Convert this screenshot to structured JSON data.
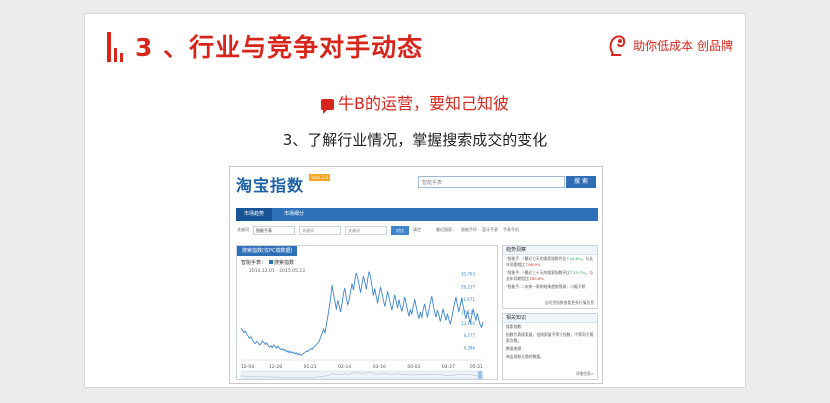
{
  "slide": {
    "title": "3 、行业与竞争对手动态",
    "brand": "助你低成本 创品牌",
    "subtitle": "牛B的运营，要知己知彼",
    "point": "3、了解行业情况，掌握搜索成交的变化",
    "colors": {
      "accent": "#d9261c",
      "blue": "#2f71b8"
    }
  },
  "screenshot": {
    "logo": "淘宝指数",
    "beta": "beta 2.0",
    "search_value": "智能手表",
    "search_button": "搜 索",
    "nav": [
      "市场趋势",
      "市场细分"
    ],
    "filters": {
      "kw1_label": "关键词",
      "kw1": "智能手表",
      "kw2": "关键词",
      "kw3": "关键词",
      "compare": "对比",
      "clear": "清空",
      "recent_label": "最近搜索：",
      "recent": [
        "智能手环",
        "蓝牙手表",
        "手表手机"
      ]
    },
    "chart": {
      "tab": "搜索指数(仅PC端数据)",
      "series_label": "智能手表：",
      "legend": "搜索指数",
      "date_range": "2014.12.01 - 2015.05.23"
    },
    "insight": {
      "title": "趋势洞察",
      "lines": [
        {
          "text": "\"智能手...\"最近七天的搜索指数环比",
          "val": "↑20.8%",
          "dir": "up",
          "tail": "，与去年同期相比",
          "val2": "↑98.9%",
          "dir2": "dn"
        },
        {
          "text": "\"智能手...\"最近三十天的搜索指数环比",
          "val": "↑13.7%",
          "dir": "up",
          "tail": "，与去年同期相比",
          "val2": "↑85.6%",
          "dir2": "dn"
        },
        {
          "text": "\"智能手...\"未来一周的结果趋势预测：小幅下跌",
          "val": "",
          "dir": "",
          "tail": "",
          "val2": "",
          "dir2": ""
        }
      ],
      "more": "去阿里指数查看更多行情信息"
    },
    "knowledge": {
      "title": "相关知识",
      "lines": [
        "搜索指数：",
        "指数代表搜索量，但搜索量不等于指数，不等同于搜索次数。",
        "数据来源：",
        "淘宝网和天猫的数据。"
      ],
      "more": "详细信息>"
    }
  },
  "chart_data": {
    "type": "line",
    "title": "搜索指数(仅PC端数据)",
    "series": [
      {
        "name": "搜索指数",
        "values": [
          11400,
          10600,
          9900,
          10400,
          9200,
          8600,
          7800,
          8300,
          7100,
          6400,
          5900,
          6700,
          6100,
          5400,
          5800,
          6800,
          6300,
          5600,
          6100,
          5200,
          4700,
          5100,
          4400,
          5400,
          4800,
          4300,
          5000,
          4200,
          3700,
          4100,
          3400,
          3800,
          2900,
          3300,
          2600,
          3100,
          2500,
          2800,
          2200,
          2600,
          1900,
          2300,
          1700,
          2100,
          2400,
          2800,
          3300,
          3000,
          3600,
          4100,
          3800,
          4600,
          5100,
          5500,
          6100,
          6800,
          8200,
          9400,
          11100,
          9800,
          12700,
          15600,
          18900,
          22400,
          26900,
          23600,
          20800,
          18100,
          21400,
          19500,
          17200,
          20300,
          23900,
          25800,
          22100,
          19900,
          21700,
          24600,
          27400,
          25100,
          28600,
          31200,
          29400,
          26800,
          24100,
          27300,
          30100,
          27900,
          25300,
          29100,
          31700,
          29800,
          26400,
          23100,
          25600,
          22800,
          20400,
          23600,
          26200,
          24100,
          21400,
          19200,
          21800,
          24600,
          22300,
          20000,
          17900,
          20500,
          23400,
          21100,
          18600,
          21700,
          19300,
          17400,
          19800,
          22600,
          20300,
          17800,
          15600,
          18200,
          16300,
          19100,
          21700,
          19300,
          16900,
          14800,
          17200,
          15100,
          18200,
          20100,
          17400,
          15300,
          17800,
          20700,
          22900,
          19800,
          17100,
          15400,
          17900,
          16100,
          13800,
          15900,
          18300,
          16100,
          14200,
          16600,
          14700,
          12800,
          15100,
          17700,
          20300,
          22600,
          19700,
          17200,
          19600,
          22100,
          19400,
          17000,
          14800,
          17500,
          15300,
          13100,
          15600,
          18400,
          16200,
          14100,
          16700,
          14500,
          12600,
          11700,
          13600
        ]
      }
    ],
    "x": [
      "12-04",
      "12-28",
      "01-21",
      "02-14",
      "03-10",
      "04-03",
      "04-27",
      "05-21"
    ],
    "y_ticks": [
      30763,
      26217,
      21671,
      17125,
      13100,
      8777,
      4386
    ],
    "y_tick_labels": [
      "30,763",
      "26,217",
      "21,671",
      "17,125",
      "13,100",
      "8,777",
      "4,386"
    ],
    "ylim": [
      0,
      33000
    ],
    "grid": false,
    "legend": "top-left"
  }
}
